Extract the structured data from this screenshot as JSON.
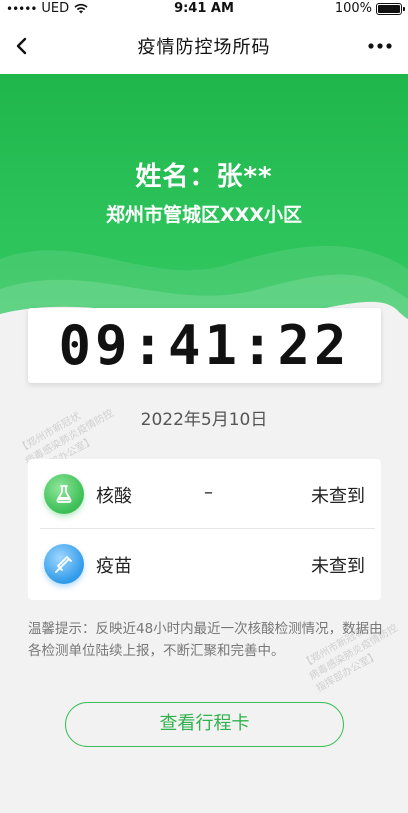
{
  "status_bar": {
    "carrier_dots": "•••••",
    "carrier": "UED",
    "time": "9:41 AM",
    "battery": "100%",
    "icons": [
      "wifi-icon",
      "battery-icon"
    ]
  },
  "nav": {
    "title": "疫情防控场所码",
    "icons": [
      "back-chevron-icon",
      "more-dots-icon"
    ]
  },
  "hero": {
    "name_line": "姓名：张**",
    "address": "郑州市管城区XXX小区",
    "color": "#1fb64b"
  },
  "clock": {
    "time": "09:41:22",
    "date": "2022年5月10日"
  },
  "watermark": {
    "line1": "【郑州市新冠状",
    "line2": "病毒感染肺炎疫情防控",
    "line3": "指挥部办公室】"
  },
  "results": [
    {
      "icon": "flask-icon",
      "label": "核酸",
      "dash": "–",
      "status": "未查到"
    },
    {
      "icon": "syringe-icon",
      "label": "疫苗",
      "status": "未查到"
    }
  ],
  "tip": "温馨提示：反映近48小时内最近一次核酸检测情况，数据由各检测单位陆续上报，不断汇聚和完善中。",
  "button": {
    "label": "查看行程卡",
    "color": "#3bbf55"
  }
}
